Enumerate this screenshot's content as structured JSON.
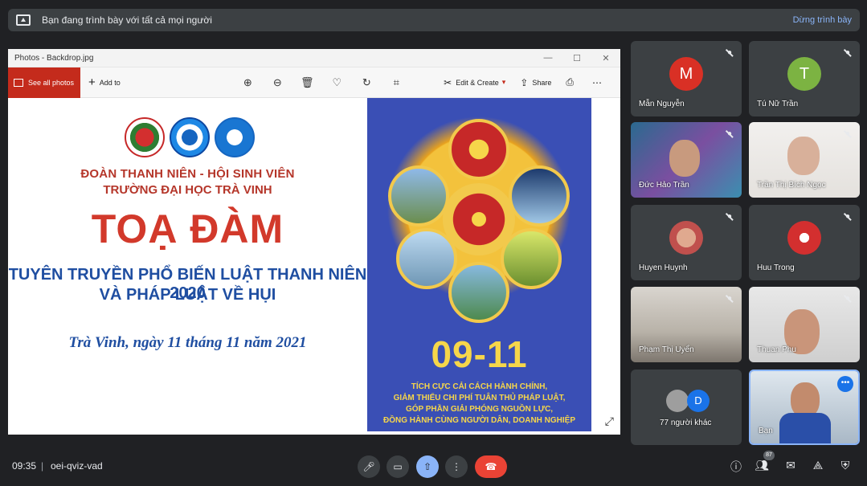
{
  "banner": {
    "text": "Bạn đang trình bày với tất cả mọi người",
    "stop_label": "Dừng trình bày"
  },
  "window": {
    "title": "Photos - Backdrop.jpg",
    "controls": [
      "—",
      "☐",
      "✕"
    ],
    "see_all": "See all photos",
    "add_to": "Add to",
    "edit_create": "Edit & Create",
    "share": "Share"
  },
  "poster": {
    "org_line1": "ĐOÀN THANH NIÊN - HỘI SINH VIÊN",
    "org_line2": "TRƯỜNG ĐẠI HỌC TRÀ VINH",
    "headline": "TOẠ ĐÀM",
    "subtitle1": "TUYÊN TRUYỀN PHỔ BIẾN LUẬT THANH NIÊN 2020",
    "subtitle2": "VÀ PHÁP LUẬT VỀ HỤI",
    "date_line": "Trà Vinh, ngày 11 tháng 11 năm 2021",
    "right_date": "09-11",
    "slogans": [
      "TÍCH CỰC CẢI CÁCH HÀNH CHÍNH,",
      "GIẢM THIỂU CHI PHÍ TUÂN THỦ PHÁP LUẬT,",
      "GÓP PHẦN GIẢI PHÓNG NGUỒN LỰC,",
      "ĐỒNG HÀNH CÙNG NGƯỜI DÂN, DOANH NGHIỆP"
    ]
  },
  "participants": [
    {
      "name": "Mẫn Nguyễn",
      "initial": "M",
      "color": "#d93025"
    },
    {
      "name": "Tú Nữ Trần",
      "initial": "T",
      "color": "#7cb342"
    },
    {
      "name": "Đức Hảo Trần"
    },
    {
      "name": "Trần Thị Bích Ngọc"
    },
    {
      "name": "Huyen Huynh"
    },
    {
      "name": "Huu Trong"
    },
    {
      "name": "Phạm Thị Uyển"
    },
    {
      "name": "Thuan Phu"
    },
    {
      "name": "77 người khác",
      "extra_initial": "D"
    },
    {
      "name": "Bạn"
    }
  ],
  "bottom": {
    "time": "09:35",
    "separator": "|",
    "meeting_code": "oei-qviz-vad",
    "people_count": "87"
  }
}
